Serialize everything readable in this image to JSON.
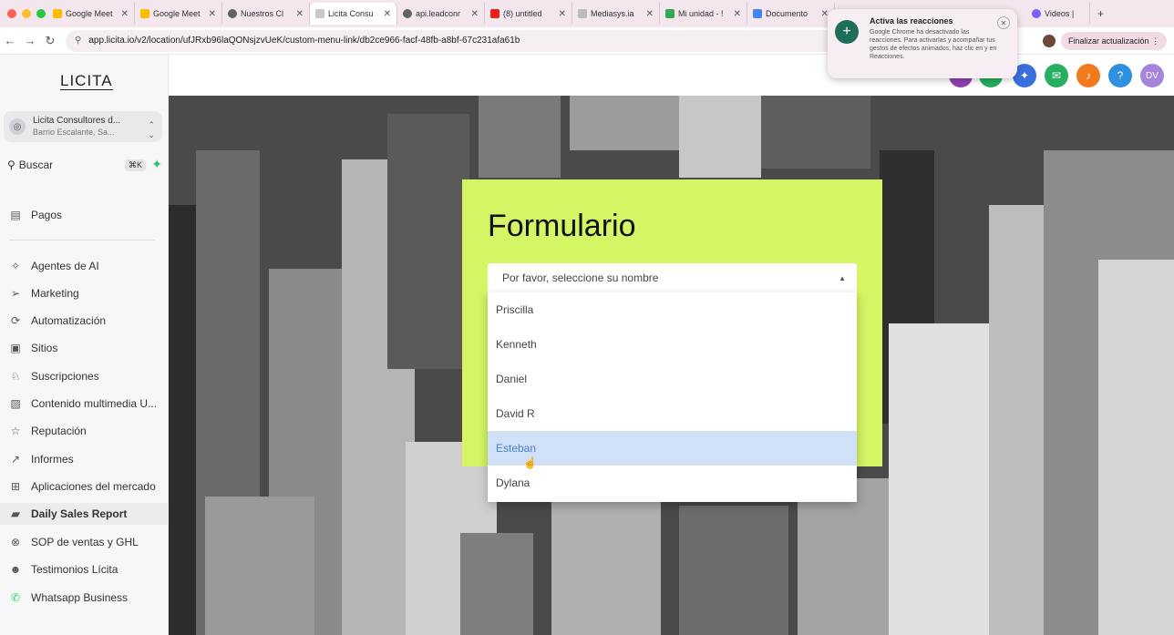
{
  "browser": {
    "tabs": [
      {
        "label": "Google Meet",
        "color": "#fbbc04"
      },
      {
        "label": "Google Meet",
        "color": "#fbbc04"
      },
      {
        "label": "Nuestros Cl",
        "color": "#5f6368"
      },
      {
        "label": "Licita Consu",
        "color": "#c8c8c8"
      },
      {
        "label": "api.leadconr",
        "color": "#5f6368"
      },
      {
        "label": "(8) untitled",
        "color": "#e62117"
      },
      {
        "label": "Mediasys.ia",
        "color": "#bbbbbb"
      },
      {
        "label": "Mi unidad - !",
        "color": "#34a853"
      },
      {
        "label": "Documento",
        "color": "#4285f4"
      },
      {
        "label": "Videos |",
        "color": "#7b61ff"
      }
    ],
    "url": "app.licita.io/v2/location/ufJRxb96laQONsjzvUeK/custom-menu-link/db2ce966-facf-48fb-a8bf-67c231afa61b",
    "update_button": "Finalizar actualización"
  },
  "popup": {
    "title": "Activa las reacciones",
    "body": "Google Chrome ha desactivado las reacciones. Para activarlas y acompañar tus gestos de efectos animados, haz clic en  y en Reacciones."
  },
  "sidebar": {
    "logo": "LICITA",
    "location_name": "Licita Consultores d...",
    "location_address": "Barrio Escalante, Sa...",
    "search_label": "Buscar",
    "search_shortcut": "⌘K",
    "items": [
      {
        "label": "Pagos",
        "icon": "receipt-icon"
      },
      {
        "label": "Agentes de AI",
        "icon": "sparkles-icon"
      },
      {
        "label": "Marketing",
        "icon": "send-icon"
      },
      {
        "label": "Automatización",
        "icon": "automation-icon"
      },
      {
        "label": "Sitios",
        "icon": "site-icon"
      },
      {
        "label": "Suscripciones",
        "icon": "membership-icon"
      },
      {
        "label": "Contenido multimedia U...",
        "icon": "media-icon"
      },
      {
        "label": "Reputación",
        "icon": "star-icon"
      },
      {
        "label": "Informes",
        "icon": "chart-icon"
      },
      {
        "label": "Aplicaciones del mercado",
        "icon": "apps-icon"
      },
      {
        "label": "Daily Sales Report",
        "icon": "report-icon"
      },
      {
        "label": "SOP de ventas y GHL",
        "icon": "xbox-icon"
      },
      {
        "label": "Testimonios Lícita",
        "icon": "users-icon"
      },
      {
        "label": "Whatsapp Business",
        "icon": "whatsapp-icon"
      }
    ]
  },
  "header": {
    "avatar_initials": "DV",
    "help_label": "?"
  },
  "form": {
    "title": "Formulario",
    "select_placeholder": "Por favor, seleccione su nombre",
    "options": [
      "Priscilla",
      "Kenneth",
      "Daniel",
      "David R",
      "Esteban",
      "Dylana"
    ],
    "highlighted": "Esteban"
  },
  "colors": {
    "form_bg": "#d4f564",
    "highlight_bg": "#cfe0f7"
  }
}
